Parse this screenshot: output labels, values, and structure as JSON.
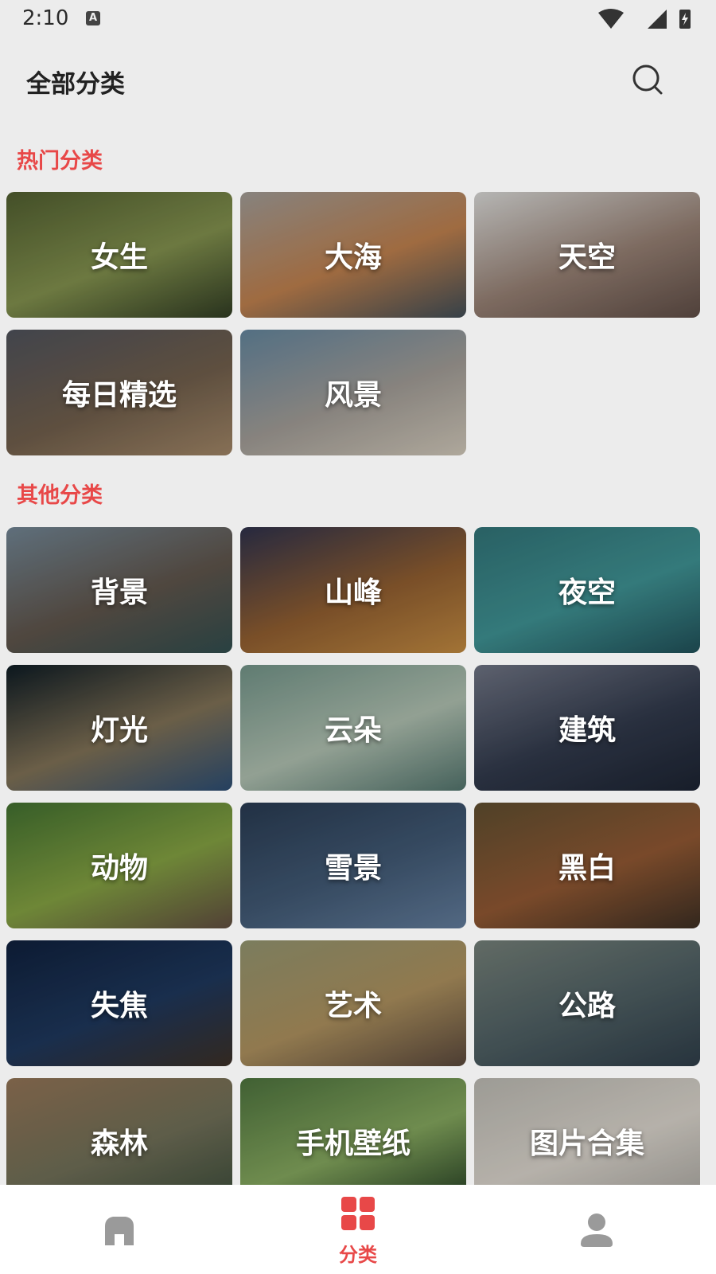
{
  "status_bar": {
    "time": "2:10",
    "notification_badge": "A"
  },
  "header": {
    "title": "全部分类",
    "search_icon": "search-icon"
  },
  "sections": {
    "hot": {
      "title": "热门分类",
      "items": [
        {
          "label": "女生",
          "colors": [
            "#4d5a2e",
            "#7c8a4a",
            "#2f3a22"
          ]
        },
        {
          "label": "大海",
          "colors": [
            "#9a9590",
            "#b57a4a",
            "#3e4a52"
          ]
        },
        {
          "label": "天空",
          "colors": [
            "#cfcfcd",
            "#8f7a6e",
            "#5b4a43"
          ]
        },
        {
          "label": "每日精选",
          "colors": [
            "#4b4e57",
            "#6b5a48",
            "#9a8062"
          ]
        },
        {
          "label": "风景",
          "colors": [
            "#5f7f96",
            "#9b9690",
            "#c7bfb1"
          ]
        }
      ]
    },
    "other": {
      "title": "其他分类",
      "items": [
        {
          "label": "背景",
          "colors": [
            "#6c7f8d",
            "#5b5148",
            "#2f4a4a"
          ]
        },
        {
          "label": "山峰",
          "colors": [
            "#2c2f48",
            "#8a5a2e",
            "#b9843e"
          ]
        },
        {
          "label": "夜空",
          "colors": [
            "#2f6e72",
            "#3c8b8c",
            "#1f4d55"
          ]
        },
        {
          "label": "灯光",
          "colors": [
            "#0d1a22",
            "#7a6c52",
            "#2a4a6e"
          ]
        },
        {
          "label": "云朵",
          "colors": [
            "#6d8d82",
            "#a7b7a8",
            "#4f6f68"
          ]
        },
        {
          "label": "建筑",
          "colors": [
            "#6a6f7e",
            "#2f3748",
            "#1b2230"
          ]
        },
        {
          "label": "动物",
          "colors": [
            "#3f6b2e",
            "#7e9a3f",
            "#5d4a3e"
          ]
        },
        {
          "label": "雪景",
          "colors": [
            "#27384e",
            "#3f5670",
            "#5e7795"
          ]
        },
        {
          "label": "黑白",
          "colors": [
            "#5b4b2e",
            "#8a5430",
            "#3a2d22"
          ]
        },
        {
          "label": "失焦",
          "colors": [
            "#0f1f3a",
            "#1d3558",
            "#3a2e25"
          ]
        },
        {
          "label": "艺术",
          "colors": [
            "#8d8f6b",
            "#a58a5a",
            "#57463a"
          ]
        },
        {
          "label": "公路",
          "colors": [
            "#6f7a73",
            "#4a5a5e",
            "#2d3b46"
          ]
        },
        {
          "label": "森林",
          "colors": [
            "#8c6f52",
            "#6b6a54",
            "#3a4a38"
          ]
        },
        {
          "label": "手机壁纸",
          "colors": [
            "#4a6e3b",
            "#7fa05a",
            "#233c22"
          ]
        },
        {
          "label": "图片合集",
          "colors": [
            "#b3b1aa",
            "#cfcac2",
            "#a3a09a"
          ]
        }
      ]
    }
  },
  "bottom_nav": {
    "items": [
      {
        "name": "home",
        "icon": "home-icon",
        "label": ""
      },
      {
        "name": "category",
        "icon": "category-grid-icon",
        "label": "分类"
      },
      {
        "name": "profile",
        "icon": "user-icon",
        "label": ""
      }
    ],
    "active_color": "#e84848",
    "inactive_color": "#9a9a9a"
  }
}
